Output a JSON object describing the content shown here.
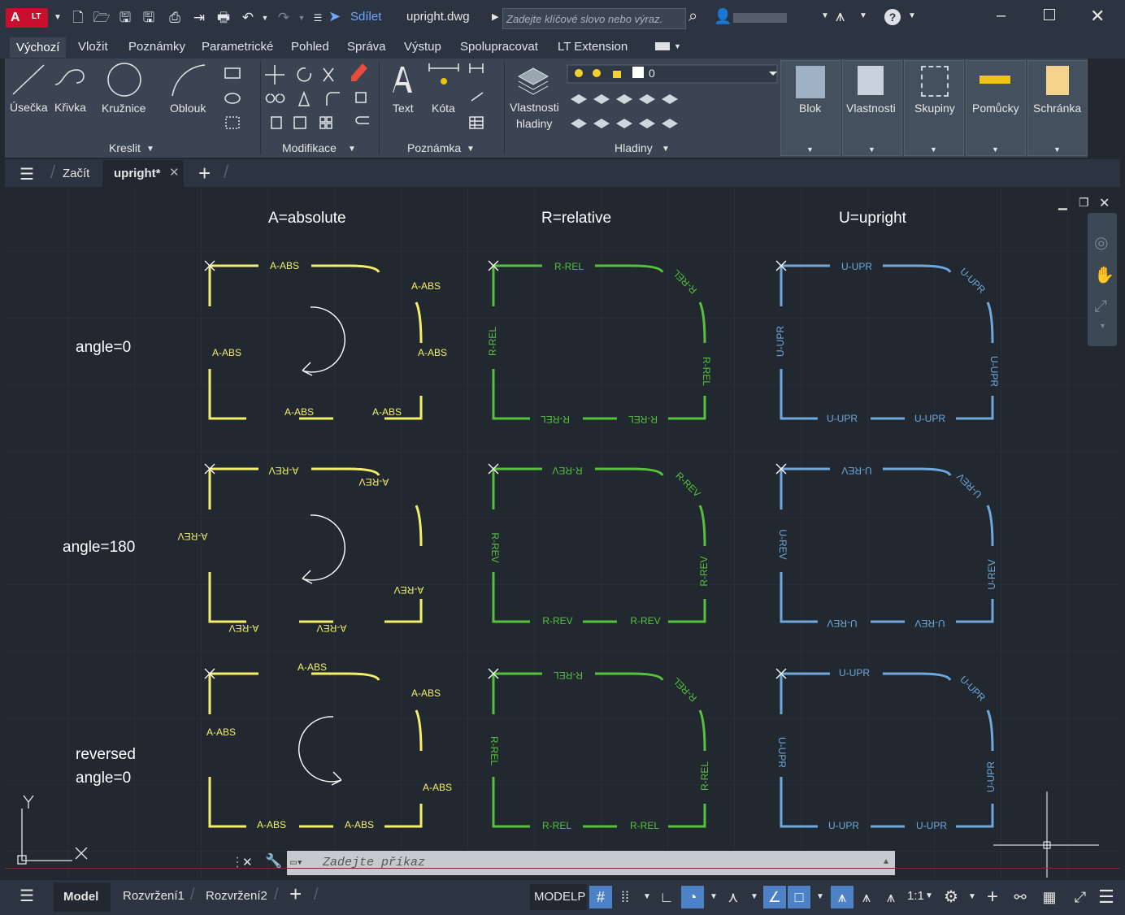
{
  "title_bar": {
    "app_badge": "A",
    "app_badge_sub": "LT",
    "share_label": "Sdílet",
    "document_title": "upright.dwg",
    "search_placeholder": "Zadejte klíčové slovo nebo výraz."
  },
  "menu": [
    "Výchozí",
    "Vložit",
    "Poznámky",
    "Parametrické",
    "Pohled",
    "Správa",
    "Výstup",
    "Spolupracovat",
    "LT Extension"
  ],
  "ribbon": {
    "draw_tools": [
      "Úsečka",
      "Křivka",
      "Kružnice",
      "Oblouk"
    ],
    "annotation_tools": [
      "Text",
      "Kóta"
    ],
    "layer_props_line1": "Vlastnosti",
    "layer_props_line2": "hladiny",
    "layer_current": "0",
    "big_buttons": [
      "Blok",
      "Vlastnosti",
      "Skupiny",
      "Pomůcky",
      "Schránka"
    ],
    "panels": [
      "Kreslit",
      "Modifikace",
      "Poznámka",
      "Hladiny"
    ]
  },
  "file_tabs": {
    "start": "Začít",
    "active": "upright*"
  },
  "drawing": {
    "col_headers": [
      "A=absolute",
      "R=relative",
      "U=upright"
    ],
    "row_labels": [
      "angle=0",
      "angle=180",
      "reversed",
      "angle=0"
    ],
    "labels": {
      "a_abs": "A-ABS",
      "r_rel": "R-REL",
      "u_upr": "U-UPR",
      "a_rev": "A-REV",
      "r_rev": "R-REV",
      "u_rev": "U-REV"
    },
    "colors": {
      "absolute": "#f4ef6a",
      "relative": "#56c13d",
      "upright": "#6fa8dc",
      "canvas_bg": "#212830",
      "grid": "#2b333d"
    }
  },
  "command_line": {
    "placeholder": "Zadejte příkaz"
  },
  "status_bar": {
    "layout_tabs": [
      "Model",
      "Rozvržení1",
      "Rozvržení2"
    ],
    "space": "MODELP",
    "scale": "1:1"
  }
}
